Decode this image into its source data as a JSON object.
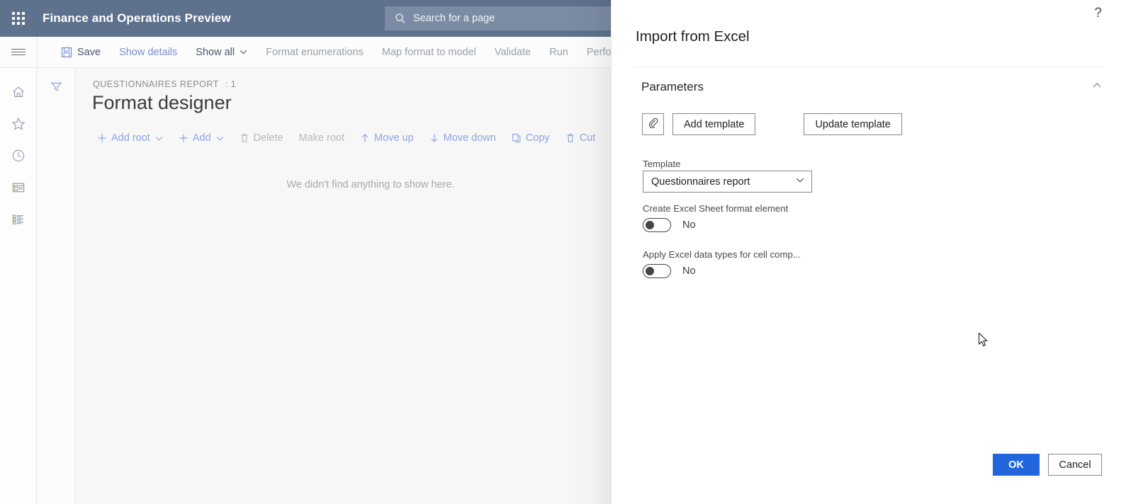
{
  "topbar": {
    "waffle_icon": "app-launcher-icon",
    "app_title": "Finance and Operations Preview",
    "search": {
      "icon": "search-icon",
      "placeholder": "Search for a page",
      "value": ""
    },
    "help_icon": "help-icon",
    "help_glyph": "?",
    "bg_color": "#5e718d",
    "search_bg_color": "#7b8ba4"
  },
  "commandbar": {
    "menu_icon": "hamburger-menu-icon",
    "items": [
      {
        "label": "Save",
        "icon": "save-icon",
        "state": "normal"
      },
      {
        "label": "Show details",
        "icon": "",
        "state": "link"
      },
      {
        "label": "Show all",
        "icon": "",
        "state": "normal",
        "chevron": true
      },
      {
        "label": "Format enumerations",
        "icon": "",
        "state": "dim"
      },
      {
        "label": "Map format to model",
        "icon": "",
        "state": "dim"
      },
      {
        "label": "Validate",
        "icon": "",
        "state": "dim"
      },
      {
        "label": "Run",
        "icon": "",
        "state": "dim"
      },
      {
        "label": "Perfo",
        "icon": "",
        "state": "dim"
      }
    ]
  },
  "rail": {
    "items": [
      {
        "name": "home-icon",
        "label": "Home"
      },
      {
        "name": "favorites-star-icon",
        "label": "Favorites"
      },
      {
        "name": "recent-clock-icon",
        "label": "Recent"
      },
      {
        "name": "workspaces-icon",
        "label": "Workspaces"
      },
      {
        "name": "modules-list-icon",
        "label": "Modules"
      }
    ]
  },
  "filter_column": {
    "icon": "filter-funnel-icon"
  },
  "main": {
    "breadcrumb": "QUESTIONNAIRES REPORT",
    "breadcrumb_suffix": ": 1",
    "page_title": "Format designer",
    "tree_toolbar": [
      {
        "label": "Add root",
        "icon": "plus-icon",
        "state": "link",
        "chevron": true
      },
      {
        "label": "Add",
        "icon": "plus-icon",
        "state": "link",
        "chevron": true
      },
      {
        "label": "Delete",
        "icon": "trash-icon",
        "state": "dim"
      },
      {
        "label": "Make root",
        "icon": "",
        "state": "dim"
      },
      {
        "label": "Move up",
        "icon": "arrow-up-icon",
        "state": "link"
      },
      {
        "label": "Move down",
        "icon": "arrow-down-icon",
        "state": "link"
      },
      {
        "label": "Copy",
        "icon": "copy-icon",
        "state": "link"
      },
      {
        "label": "Cut",
        "icon": "trash-icon",
        "state": "link"
      }
    ],
    "empty_message": "We didn't find anything to show here."
  },
  "dialog": {
    "help_glyph": "?",
    "help_icon": "help-icon",
    "title": "Import from Excel",
    "section": {
      "title": "Parameters",
      "collapse_icon": "chevron-up-icon"
    },
    "attach_button": {
      "icon": "paperclip-icon",
      "label": ""
    },
    "add_template_button": "Add template",
    "update_template_button": "Update template",
    "accent_color": "#1d6ce0",
    "template_field": {
      "label": "Template",
      "value": "Questionnaires report",
      "chevron_icon": "chevron-down-icon"
    },
    "toggles": [
      {
        "label": "Create Excel Sheet format element",
        "value": "No",
        "checked": false
      },
      {
        "label": "Apply Excel data types for cell comp...",
        "value": "No",
        "checked": false
      }
    ],
    "ok_button": "OK",
    "cancel_button": "Cancel"
  }
}
